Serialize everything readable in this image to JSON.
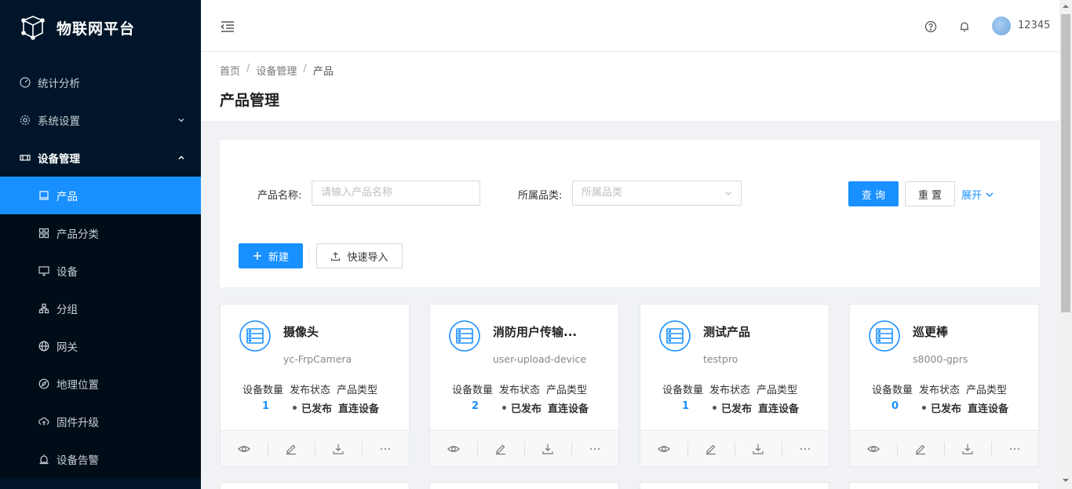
{
  "app": {
    "title": "物联网平台"
  },
  "sidebar": {
    "items": [
      {
        "label": "统计分析",
        "icon": "dashboard-icon"
      },
      {
        "label": "系统设置",
        "icon": "gear-icon",
        "expand": "collapsed"
      },
      {
        "label": "设备管理",
        "icon": "device-manage-icon",
        "expand": "open"
      }
    ],
    "sub_items": [
      {
        "label": "产品",
        "icon": "product-icon",
        "active": true
      },
      {
        "label": "产品分类",
        "icon": "category-icon"
      },
      {
        "label": "设备",
        "icon": "monitor-icon"
      },
      {
        "label": "分组",
        "icon": "group-icon"
      },
      {
        "label": "网关",
        "icon": "globe-icon"
      },
      {
        "label": "地理位置",
        "icon": "compass-icon"
      },
      {
        "label": "固件升级",
        "icon": "cloud-upload-icon"
      },
      {
        "label": "设备告警",
        "icon": "alarm-icon"
      }
    ]
  },
  "header": {
    "username": "12345"
  },
  "breadcrumb": [
    "首页",
    "设备管理",
    "产品"
  ],
  "page": {
    "title": "产品管理"
  },
  "search": {
    "name_label": "产品名称:",
    "name_placeholder": "请输入产品名称",
    "category_label": "所属品类:",
    "category_placeholder": "所属品类",
    "query_btn": "查 询",
    "reset_btn": "重 置",
    "expand_link": "展开"
  },
  "toolbar": {
    "new_btn": "新建",
    "import_btn": "快速导入"
  },
  "card_stat_labels": [
    "设备数量",
    "发布状态",
    "产品类型"
  ],
  "cards": [
    {
      "title": "摄像头",
      "subtitle": "yc-FrpCamera",
      "count": "1",
      "status": "已发布",
      "type": "直连设备"
    },
    {
      "title": "消防用户传输...",
      "subtitle": "user-upload-device",
      "count": "2",
      "status": "已发布",
      "type": "直连设备"
    },
    {
      "title": "测试产品",
      "subtitle": "testpro",
      "count": "1",
      "status": "已发布",
      "type": "直连设备"
    },
    {
      "title": "巡更棒",
      "subtitle": "s8000-gprs",
      "count": "0",
      "status": "已发布",
      "type": "直连设备"
    }
  ],
  "colors": {
    "primary": "#1890ff",
    "sidebar_bg": "#001529",
    "submenu_bg": "#000c17"
  }
}
